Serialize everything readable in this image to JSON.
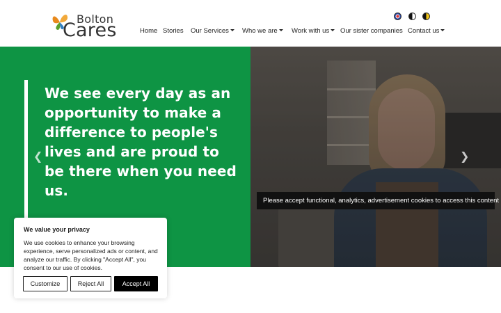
{
  "header": {
    "logo": {
      "line1": "Bolton",
      "line2": "Cares"
    },
    "utility_icons": [
      "language-icon",
      "contrast-icon",
      "yellow-contrast-icon"
    ],
    "nav": [
      {
        "label": "Home",
        "dropdown": false
      },
      {
        "label": "Stories",
        "dropdown": false
      },
      {
        "label": "Our Services",
        "dropdown": true
      },
      {
        "label": "Who we are",
        "dropdown": true
      },
      {
        "label": "Work with us",
        "dropdown": true
      },
      {
        "label": "Our sister companies",
        "dropdown": false
      },
      {
        "label": "Contact us",
        "dropdown": true
      }
    ]
  },
  "hero": {
    "heading": "We see every day as an opportunity to make a difference to people's lives and are proud to be there when you need us.",
    "cookie_notice": "Please accept functional, analytics, advertisement cookies to access this content",
    "prev_icon": "chevron-left-icon",
    "next_icon": "chevron-right-icon"
  },
  "consent": {
    "title": "We value your privacy",
    "text": "We use cookies to enhance your browsing experience, serve personalized ads or content, and analyze our traffic. By clicking \"Accept All\", you consent to our use of cookies.",
    "customize_label": "Customize",
    "reject_label": "Reject All",
    "accept_label": "Accept All"
  },
  "colors": {
    "brand_green": "#0e9444",
    "logo_orange": "#e8891c",
    "logo_green": "#5aa02c",
    "accept_button": "#000000"
  }
}
